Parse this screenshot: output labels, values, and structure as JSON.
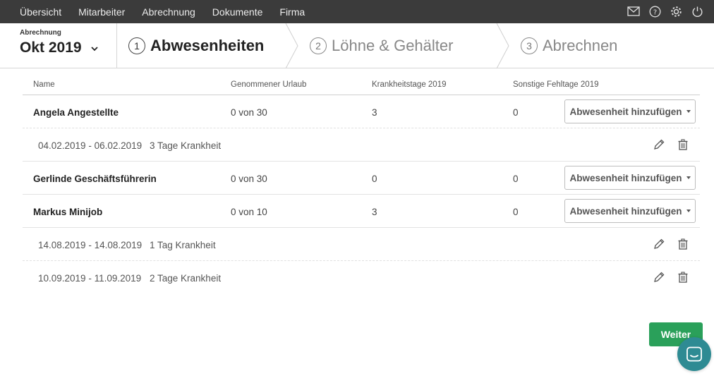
{
  "nav": {
    "items": [
      "Übersicht",
      "Mitarbeiter",
      "Abrechnung",
      "Dokumente",
      "Firma"
    ],
    "icons": [
      "mail-icon",
      "help-icon",
      "gear-icon",
      "power-icon"
    ]
  },
  "period": {
    "label": "Abrechnung",
    "value": "Okt 2019"
  },
  "steps": [
    {
      "num": "1",
      "label": "Abwesenheiten",
      "state": "active"
    },
    {
      "num": "2",
      "label": "Löhne & Gehälter",
      "state": "inactive"
    },
    {
      "num": "3",
      "label": "Abrechnen",
      "state": "inactive"
    }
  ],
  "table": {
    "headers": {
      "name": "Name",
      "urlaub": "Genommener Urlaub",
      "krank": "Krankheitstage 2019",
      "sonst": "Sonstige Fehltage 2019"
    },
    "add_label": "Abwesenheit hinzufügen",
    "employees": [
      {
        "name": "Angela Angestellte",
        "urlaub": "0 von 30",
        "krank": "3",
        "sonst": "0",
        "absences": [
          {
            "date": "04.02.2019 - 06.02.2019",
            "desc": "3 Tage Krankheit"
          }
        ]
      },
      {
        "name": "Gerlinde Geschäftsführerin",
        "urlaub": "0 von 30",
        "krank": "0",
        "sonst": "0",
        "absences": []
      },
      {
        "name": "Markus Minijob",
        "urlaub": "0 von 10",
        "krank": "3",
        "sonst": "0",
        "absences": [
          {
            "date": "14.08.2019 - 14.08.2019",
            "desc": "1 Tag Krankheit"
          },
          {
            "date": "10.09.2019 - 11.09.2019",
            "desc": "2 Tage Krankheit"
          }
        ]
      }
    ]
  },
  "footer": {
    "next_label": "Weiter"
  },
  "colors": {
    "nav_bg": "#3b3b3b",
    "primary_green": "#2aa05a",
    "chat_teal": "#2e8b93"
  }
}
